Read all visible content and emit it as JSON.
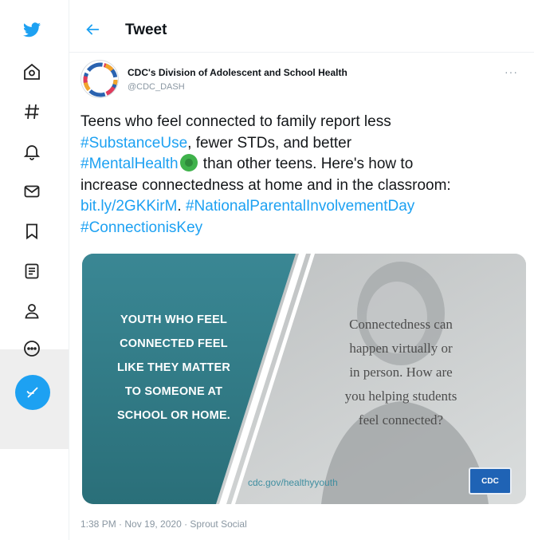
{
  "nav": {
    "items": [
      {
        "name": "twitter-logo-icon"
      },
      {
        "name": "home-icon"
      },
      {
        "name": "explore-hash-icon"
      },
      {
        "name": "notifications-bell-icon"
      },
      {
        "name": "messages-envelope-icon"
      },
      {
        "name": "bookmarks-icon"
      },
      {
        "name": "lists-icon"
      },
      {
        "name": "profile-icon"
      },
      {
        "name": "more-circle-icon"
      }
    ],
    "compose_icon": "compose-feather-icon"
  },
  "header": {
    "title": "Tweet"
  },
  "tweet": {
    "author_name": "CDC's Division of Adolescent and School Health",
    "author_handle": "@CDC_DASH",
    "more": "···",
    "text": {
      "l1": "Teens who feel connected to family report less",
      "l2_link": "#SubstanceUse",
      "l2_rest": ", fewer STDs, and better",
      "l3_link": "#MentalHealth",
      "l3_rest": " than other teens. Here's how to",
      "l4": "increase connectedness at home and in the classroom:",
      "l5_link1": "bit.ly/2GKKirM",
      "l5_sep": ". ",
      "l5_link2": "#NationalParentalInvolvementDay",
      "l6_link": "#ConnectionisKey"
    },
    "media": {
      "left_lines": [
        "YOUTH WHO FEEL",
        "CONNECTED FEEL",
        "LIKE THEY MATTER",
        "TO SOMEONE AT",
        "SCHOOL OR HOME."
      ],
      "right_lines": [
        "Connectedness can",
        "happen virtually or",
        "in person. How are",
        "you helping students",
        "feel connected?"
      ],
      "url": "cdc.gov/healthyyouth",
      "badge": "CDC"
    },
    "meta": "1:38 PM · Nov 19, 2020 · Sprout Social"
  },
  "colors": {
    "accent": "#1da1f2",
    "teal_panel": "#2d7d8a"
  }
}
